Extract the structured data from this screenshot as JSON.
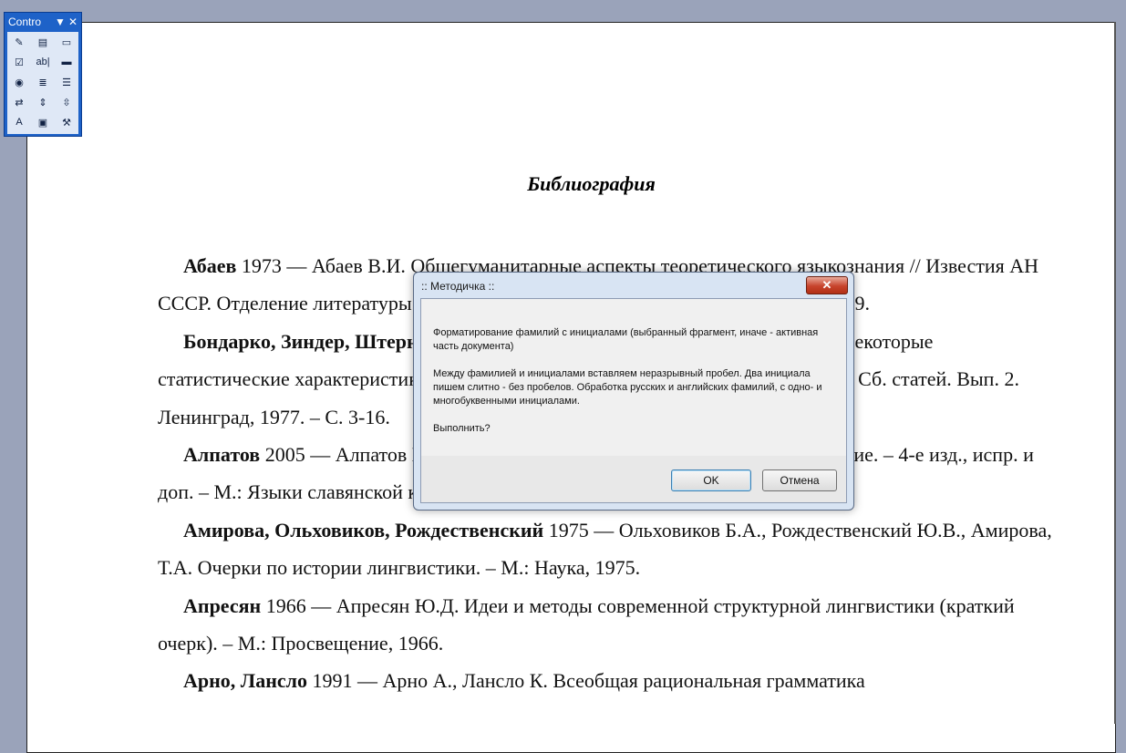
{
  "toolbox": {
    "title": "Contro",
    "buttons": [
      {
        "name": "design-mode-icon",
        "glyph": "✎"
      },
      {
        "name": "properties-icon",
        "glyph": "▤"
      },
      {
        "name": "view-code-icon",
        "glyph": "▭"
      },
      {
        "name": "checkbox-control-icon",
        "glyph": "☑"
      },
      {
        "name": "textbox-control-icon",
        "glyph": "ab|"
      },
      {
        "name": "command-button-icon",
        "glyph": "▬"
      },
      {
        "name": "option-button-icon",
        "glyph": "◉"
      },
      {
        "name": "listbox-control-icon",
        "glyph": "≣"
      },
      {
        "name": "combobox-control-icon",
        "glyph": "☰"
      },
      {
        "name": "toggle-button-icon",
        "glyph": "⇄"
      },
      {
        "name": "spin-button-icon",
        "glyph": "⇕"
      },
      {
        "name": "scrollbar-control-icon",
        "glyph": "⇳"
      },
      {
        "name": "label-control-icon",
        "glyph": "A"
      },
      {
        "name": "image-control-icon",
        "glyph": "▣"
      },
      {
        "name": "more-controls-icon",
        "glyph": "⚒"
      }
    ]
  },
  "document": {
    "title": "Библиография",
    "entries": [
      {
        "bold": "Абаев",
        "text": " 1973 — Абаев В.И. Общегуманитарные аспекты теоретического языкознания // Известия АН СССР. Отделение литературы и языка. – Т. XXXII. Вып. 6. – М., 1973. – С. 524-529."
      },
      {
        "bold": "Бондарко, Зиндер, Штерн",
        "text": " 1977 — Бондарко Л.В., Зиндер Л.Р., Штерн А.С.  Некоторые статистические характеристики русской речи // Слух и речь в норме и патологии. Сб. статей. Вып. 2. Ленинград, 1977. – С. 3-16."
      },
      {
        "bold": "Алпатов",
        "text": " 2005 — Алпатов В.М. История лингвистических учений: учеб пособие. – 4-е изд., испр. и доп. – М.: Языки славянской культуры, 2005."
      },
      {
        "bold": "Амирова, Ольховиков, Рождественский",
        "text": " 1975 — Ольховиков Б.А., Рождественский Ю.В., Амирова, Т.А. Очерки по истории лингвистики. – М.: Наука, 1975."
      },
      {
        "bold": "Апресян",
        "text": " 1966 — Апресян Ю.Д. Идеи и методы современной структурной лингвистики (краткий очерк). – М.: Просвещение, 1966."
      },
      {
        "bold": "Арно, Лансло",
        "text": " 1991 — Арно А., Лансло К. Всеобщая рациональная грамматика"
      }
    ]
  },
  "dialog": {
    "title": ":: Методичка ::",
    "close_glyph": "✕",
    "paragraphs": [
      "Форматирование фамилий с инициалами (выбранный фрагмент, иначе - активная часть документа)",
      "Между фамилией и инициалами вставляем неразрывный пробел. Два инициала пишем слитно - без пробелов. Обработка русских и английских фамилий, с одно- и многобуквенными инициалами.",
      "Выполнить?"
    ],
    "ok_label": "OK",
    "cancel_label": "Отмена"
  }
}
